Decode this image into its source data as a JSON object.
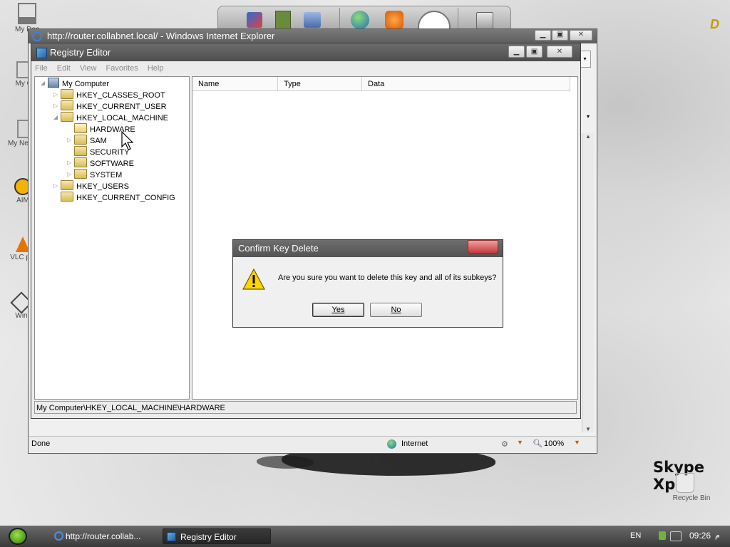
{
  "desktop": {
    "icons": [
      {
        "label": "My Doc"
      },
      {
        "label": "My Co"
      },
      {
        "label": "My Ne Pla"
      },
      {
        "label": "AIM"
      },
      {
        "label": "VLC pla"
      },
      {
        "label": "Win"
      }
    ],
    "recycle_label": "Recycle Bin",
    "skype_logo": "Skype Xp"
  },
  "ie": {
    "title": "http://router.collabnet.local/ - Windows Internet Explorer",
    "status_text": "Done",
    "zone": "Internet",
    "zoom": "100%"
  },
  "regedit": {
    "title": "Registry Editor",
    "menu": [
      "File",
      "Edit",
      "View",
      "Favorites",
      "Help"
    ],
    "tree": {
      "root": "My Computer",
      "nodes": [
        "HKEY_CLASSES_ROOT",
        "HKEY_CURRENT_USER",
        "HKEY_LOCAL_MACHINE",
        "HARDWARE",
        "SAM",
        "SECURITY",
        "SOFTWARE",
        "SYSTEM",
        "HKEY_USERS",
        "HKEY_CURRENT_CONFIG"
      ]
    },
    "columns": [
      "Name",
      "Type",
      "Data"
    ],
    "status_path": "My Computer\\HKEY_LOCAL_MACHINE\\HARDWARE"
  },
  "dialog": {
    "title": "Confirm Key Delete",
    "message": "Are you sure you want to delete this key and all of its subkeys?",
    "yes_label": "Yes",
    "no_label": "No"
  },
  "taskbar": {
    "items": [
      {
        "label": "http://router.collab..."
      },
      {
        "label": "Registry Editor"
      }
    ],
    "language": "EN",
    "time": "09:26",
    "ampm": "م"
  }
}
